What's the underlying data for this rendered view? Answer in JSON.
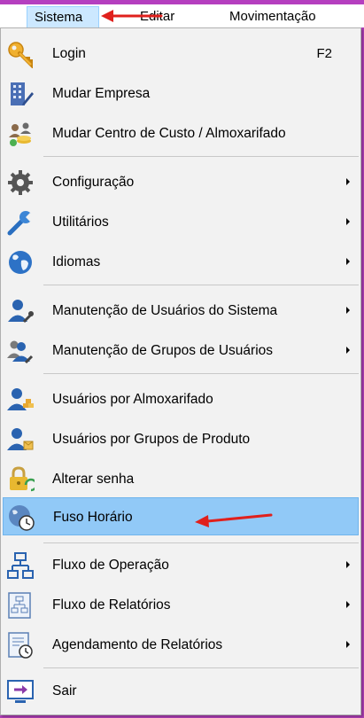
{
  "menubar": {
    "items": [
      {
        "label": "Sistema",
        "active": true
      },
      {
        "label": "Editar"
      },
      {
        "label": "Movimentação"
      }
    ]
  },
  "menu": {
    "items": [
      {
        "label": "Login",
        "shortcut": "F2",
        "icon": "key-icon"
      },
      {
        "label": "Mudar Empresa",
        "icon": "building-edit-icon"
      },
      {
        "label": "Mudar Centro de Custo / Almoxarifado",
        "icon": "users-coins-icon"
      },
      {
        "label": "Configuração",
        "icon": "gear-icon",
        "submenu": true
      },
      {
        "label": "Utilitários",
        "icon": "wrench-icon",
        "submenu": true
      },
      {
        "label": "Idiomas",
        "icon": "globe-icon",
        "submenu": true
      },
      {
        "label": "Manutenção de Usuários do Sistema",
        "icon": "user-wrench-icon",
        "submenu": true
      },
      {
        "label": "Manutenção de Grupos de Usuários",
        "icon": "users-wrench-icon",
        "submenu": true
      },
      {
        "label": "Usuários por Almoxarifado",
        "icon": "user-boxes-icon"
      },
      {
        "label": "Usuários por Grupos de Produto",
        "icon": "user-products-icon"
      },
      {
        "label": "Alterar senha",
        "icon": "padlock-refresh-icon"
      },
      {
        "label": "Fuso Horário",
        "icon": "globe-clock-icon",
        "highlighted": true
      },
      {
        "label": "Fluxo de Operação",
        "icon": "flowchart-icon",
        "submenu": true
      },
      {
        "label": "Fluxo de Relatórios",
        "icon": "report-flow-icon",
        "submenu": true
      },
      {
        "label": "Agendamento de Relatórios",
        "icon": "report-clock-icon",
        "submenu": true
      },
      {
        "label": "Sair",
        "icon": "exit-monitor-icon"
      }
    ]
  },
  "colors": {
    "highlight": "#91c9f7",
    "menubar_active": "#cce8ff",
    "annotation_arrow": "#e0201c",
    "window_border": "#b53fbf"
  }
}
